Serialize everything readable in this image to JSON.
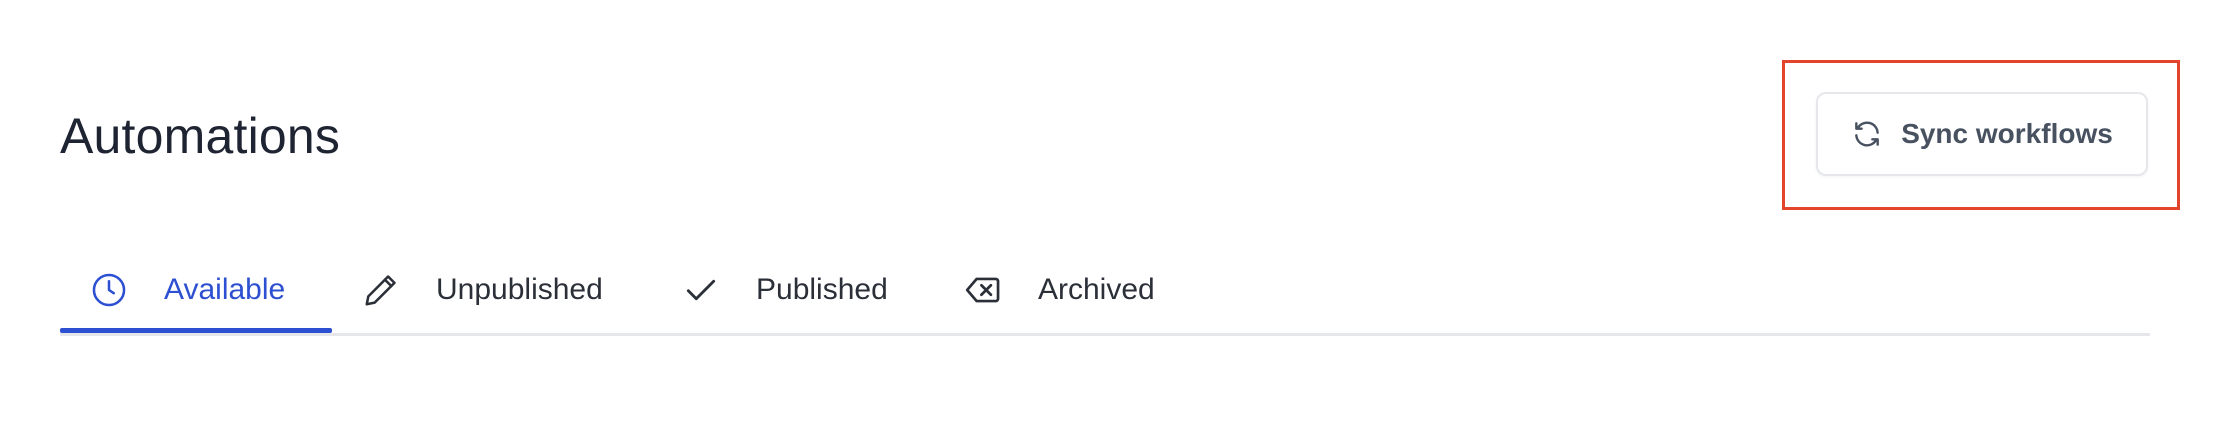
{
  "header": {
    "title": "Automations"
  },
  "actions": {
    "sync_label": "Sync workflows",
    "sync_icon": "refresh-icon"
  },
  "tabs": [
    {
      "label": "Available",
      "icon": "clock-icon",
      "active": true
    },
    {
      "label": "Unpublished",
      "icon": "pencil-icon",
      "active": false
    },
    {
      "label": "Published",
      "icon": "check-icon",
      "active": false
    },
    {
      "label": "Archived",
      "icon": "backspace-x-icon",
      "active": false
    }
  ],
  "colors": {
    "accent": "#2d4fd1",
    "highlight": "#e2452b",
    "text": "#1f2433",
    "divider": "#e5e7eb"
  }
}
